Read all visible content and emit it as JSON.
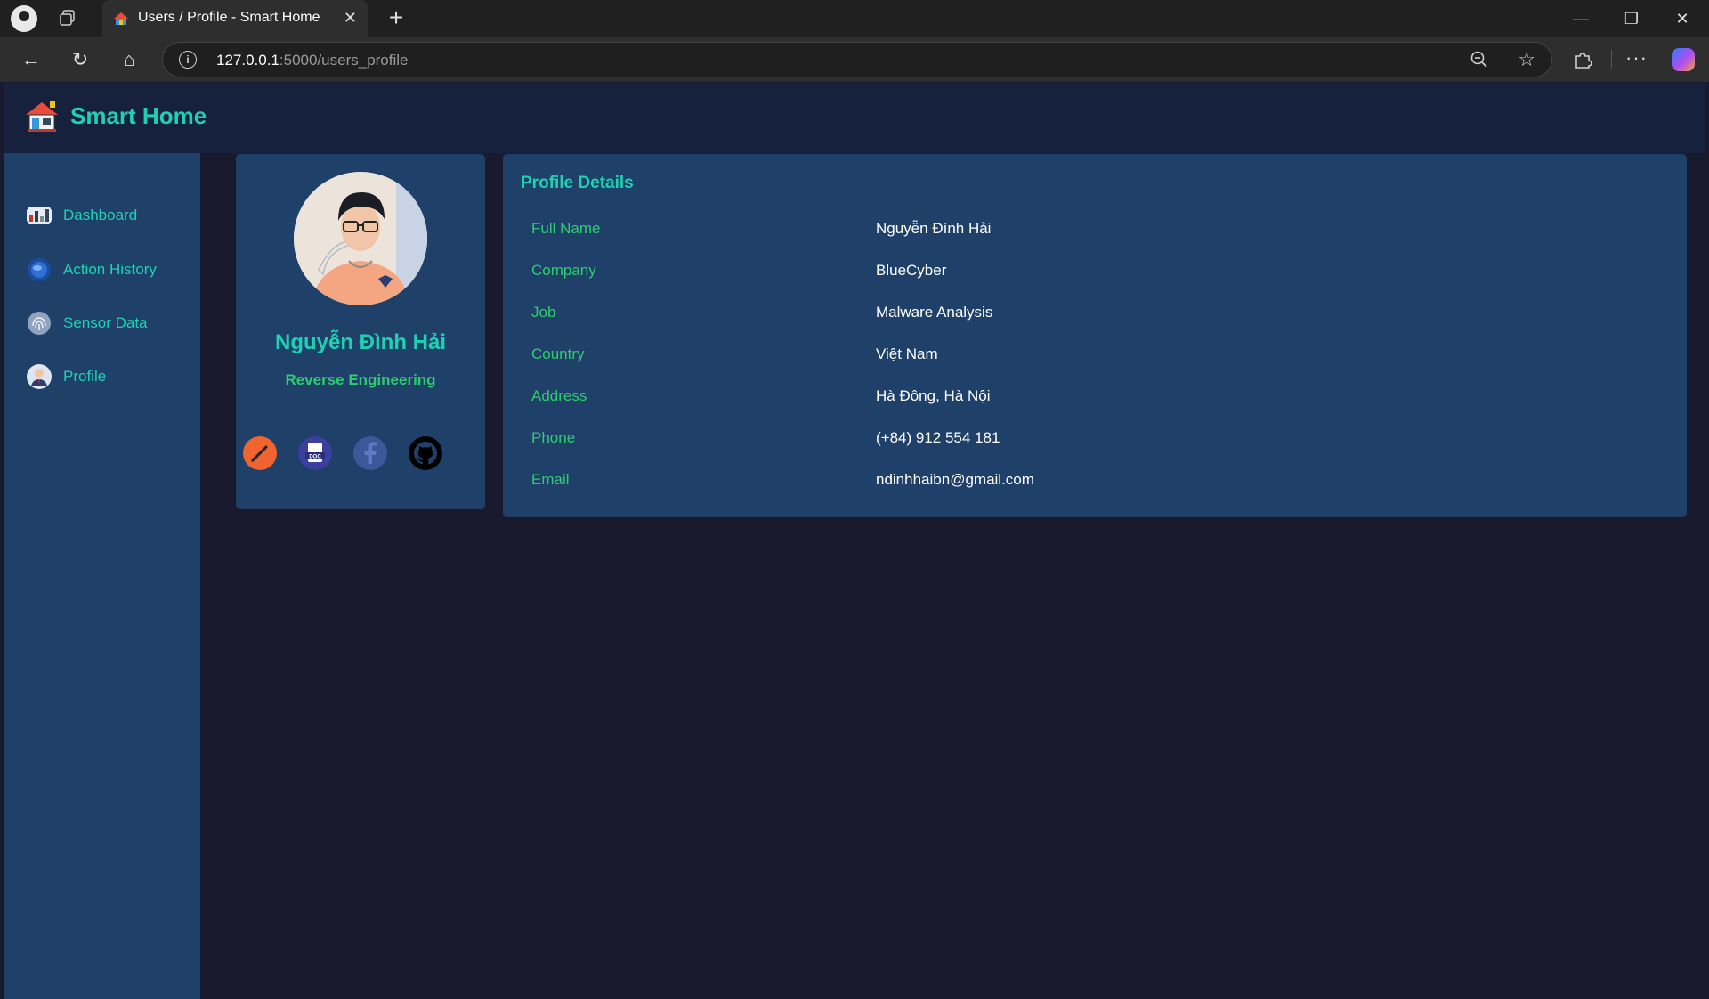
{
  "browser": {
    "tab_title": "Users / Profile - Smart Home",
    "tab_close": "✕",
    "new_tab": "+",
    "url_host": "127.0.0.1",
    "url_rest": ":5000/users_profile",
    "window_controls": [
      "—",
      "❐",
      "✕"
    ],
    "nav": {
      "back": "←",
      "reload": "↻",
      "home": "⌂"
    },
    "more": "···",
    "star": "☆"
  },
  "app": {
    "brand": "Smart Home"
  },
  "sidebar": {
    "items": [
      {
        "label": "Dashboard",
        "icon": "dashboard-icon",
        "color": "#c0392b"
      },
      {
        "label": "Action History",
        "icon": "globe-icon",
        "color": "#2f6fd6"
      },
      {
        "label": "Sensor Data",
        "icon": "fingerprint-icon",
        "color": "#8fa3bf"
      },
      {
        "label": "Profile",
        "icon": "user-avatar-icon",
        "color": "#dfe6ef"
      }
    ]
  },
  "profile_card": {
    "name": "Nguyễn Đình Hải",
    "role": "Reverse Engineering",
    "social": [
      {
        "icon": "pen-icon",
        "color": "#f0652f"
      },
      {
        "icon": "doc-file-icon",
        "color": "#3c3f9e"
      },
      {
        "icon": "facebook-icon",
        "color": "#3b5998"
      },
      {
        "icon": "github-icon",
        "color": "#000000"
      }
    ]
  },
  "details": {
    "title": "Profile Details",
    "rows": [
      {
        "label": "Full Name",
        "value": "Nguyễn Đình Hải"
      },
      {
        "label": "Company",
        "value": "BlueCyber"
      },
      {
        "label": "Job",
        "value": "Malware Analysis"
      },
      {
        "label": "Country",
        "value": "Việt Nam"
      },
      {
        "label": "Address",
        "value": "Hà Đông, Hà Nội"
      },
      {
        "label": "Phone",
        "value": "(+84) 912 554 181"
      },
      {
        "label": "Email",
        "value": "ndinhhaibn@gmail.com"
      }
    ]
  },
  "colors": {
    "accent": "#1fd1b2",
    "label_green": "#2ecc71",
    "panel": "#1f4068",
    "header": "#16213e",
    "background": "#1a1a2e"
  }
}
